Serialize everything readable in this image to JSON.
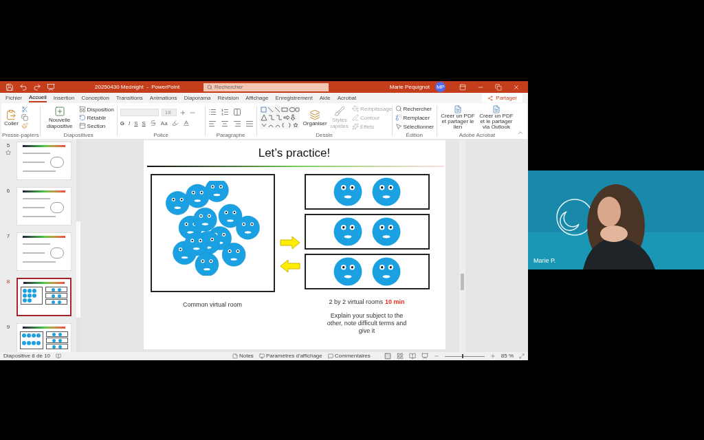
{
  "title_bar": {
    "file_title": "20250430 Mednight  -  PowerPoint",
    "search_placeholder": "Rechercher",
    "user_name": "Marie Pequignot",
    "user_initials": "MP"
  },
  "ribbon_tabs": [
    {
      "label": "Fichier",
      "selected": false
    },
    {
      "label": "Accueil",
      "selected": true
    },
    {
      "label": "Insertion",
      "selected": false
    },
    {
      "label": "Conception",
      "selected": false
    },
    {
      "label": "Transitions",
      "selected": false
    },
    {
      "label": "Animations",
      "selected": false
    },
    {
      "label": "Diaporama",
      "selected": false
    },
    {
      "label": "Révision",
      "selected": false
    },
    {
      "label": "Affichage",
      "selected": false
    },
    {
      "label": "Enregistrement",
      "selected": false
    },
    {
      "label": "Aide",
      "selected": false
    },
    {
      "label": "Acrobat",
      "selected": false
    }
  ],
  "share_button": "Partager",
  "groups": {
    "clipboard": {
      "label": "Presse-papiers",
      "paste": "Coller"
    },
    "slides": {
      "label": "Diapositives",
      "new_slide": "Nouvelle diapositive",
      "items": [
        "Disposition",
        "Rétablir",
        "Section"
      ]
    },
    "font": {
      "label": "Police",
      "font_size": "18",
      "format_buttons": [
        "G",
        "I",
        "S",
        "S"
      ],
      "case_button": "Aa"
    },
    "paragraph": {
      "label": "Paragraphe"
    },
    "drawing": {
      "label": "Dessin",
      "arrange": "Organiser",
      "quick_styles": {
        "label": "Styles rapides",
        "disabled": true
      },
      "items": [
        {
          "label": "Remplissage",
          "disabled": true
        },
        {
          "label": "Contour",
          "disabled": true
        },
        {
          "label": "Effets",
          "disabled": true
        }
      ]
    },
    "editing": {
      "label": "Édition",
      "items": [
        "Rechercher",
        "Remplacer",
        "Sélectionner"
      ]
    },
    "acrobat": {
      "label": "Adobe Acrobat",
      "items": [
        "Créer un PDF et partager le lien",
        "Créer un PDF et le partager via Outlook"
      ]
    }
  },
  "thumbnails": [
    {
      "number": "5",
      "kind": "notes",
      "selected": false,
      "animated": true
    },
    {
      "number": "6",
      "kind": "notes",
      "selected": false,
      "animated": false
    },
    {
      "number": "7",
      "kind": "notes",
      "selected": false,
      "animated": false
    },
    {
      "number": "8",
      "kind": "rooms",
      "selected": true,
      "animated": false
    },
    {
      "number": "9",
      "kind": "rooms",
      "selected": false,
      "animated": false
    }
  ],
  "slide": {
    "title": "Let’s practice!",
    "left_caption": "Common virtual room",
    "right_caption": {
      "text": "2 by 2 virtual rooms",
      "highlight": "10 min"
    },
    "instruction": "Explain your subject to the other, note difficult terms and give it"
  },
  "status_bar": {
    "slide_position": "Diapositive 8 de 10",
    "notes": "Notes",
    "display_settings": "Paramètres d'affichage",
    "comments": "Commentaires",
    "zoom": {
      "level": 0.43,
      "reading": "85 %"
    }
  },
  "video": {
    "name": "Marie P."
  }
}
